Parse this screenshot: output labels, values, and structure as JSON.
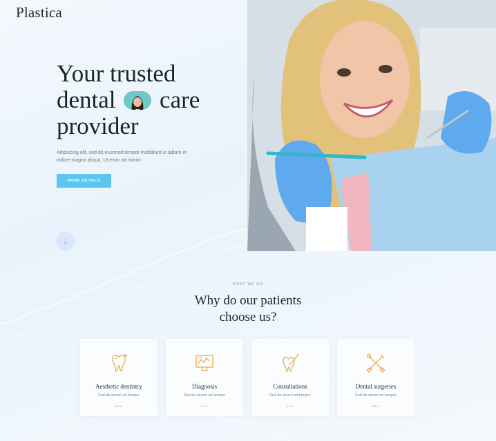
{
  "header": {
    "logo": "Plastica",
    "icons": [
      "menu-icon",
      "shopping-bag-icon",
      "search-icon"
    ]
  },
  "hero": {
    "title_line1": "Your trusted",
    "title_line2a": "dental",
    "title_line2b": "care",
    "title_line3": "provider",
    "description": "Adipiscing elit, sed do eiusmod tempor incididunt ut labore et dolore magna aliqua. Ut enim ad minim",
    "button_label": "MORE DETAILS",
    "scroll_icon": "scroll-down-icon"
  },
  "services": {
    "eyebrow": "WHAT WE DO",
    "title": "Why do our patients choose us?",
    "cards": [
      {
        "title": "Aesthetic dentistry",
        "subtitle": "Sed do eiusm od tempor",
        "icon": "tooth-sparkle-icon"
      },
      {
        "title": "Diagnosis",
        "subtitle": "Sed do eiusm od tempor",
        "icon": "monitor-chart-icon"
      },
      {
        "title": "Consultations",
        "subtitle": "Sed do eiusm od tempor",
        "icon": "tooth-tool-icon"
      },
      {
        "title": "Dental surgeries",
        "subtitle": "Sed do eiusm od tempor",
        "icon": "crossed-tools-icon"
      }
    ]
  },
  "colors": {
    "accent": "#5cc6ee",
    "icon_orange": "#f0a23c",
    "text_dark": "#162626"
  }
}
